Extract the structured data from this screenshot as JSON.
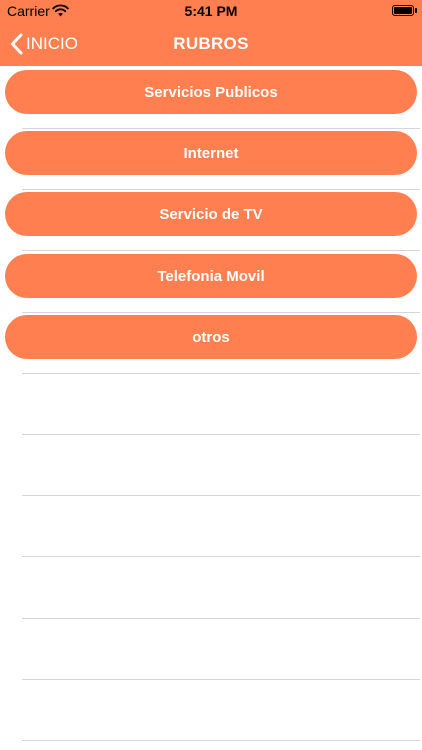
{
  "status_bar": {
    "carrier": "Carrier",
    "time": "5:41 PM",
    "battery_level": 1.0
  },
  "nav": {
    "back_label": "INICIO",
    "title": "RUBROS"
  },
  "colors": {
    "accent": "#ff7f50",
    "text_on_accent": "#ffffff",
    "separator": "#d6d6d6"
  },
  "rubros": [
    {
      "label": "Servicios Publicos"
    },
    {
      "label": "Internet"
    },
    {
      "label": "Servicio de TV"
    },
    {
      "label": "Telefonia Movil"
    },
    {
      "label": "otros"
    }
  ]
}
